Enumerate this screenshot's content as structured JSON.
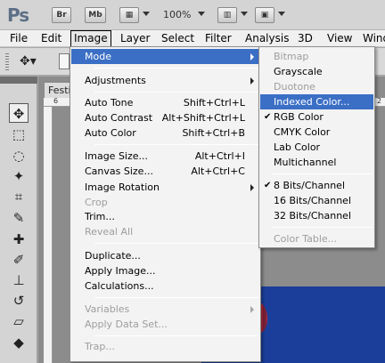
{
  "app": {
    "logo": "Ps",
    "buttons": [
      "Br",
      "Mb"
    ],
    "zoom": "100%"
  },
  "menubar": {
    "items": [
      "File",
      "Edit",
      "Image",
      "Layer",
      "Select",
      "Filter",
      "Analysis",
      "3D",
      "View",
      "Windo"
    ]
  },
  "document": {
    "tab_label": "Festi",
    "ruler_ticks": [
      "6",
      "2"
    ]
  },
  "image_menu": {
    "mode": "Mode",
    "adjustments": "Adjustments",
    "auto_tone": "Auto Tone",
    "auto_tone_sc": "Shift+Ctrl+L",
    "auto_contrast": "Auto Contrast",
    "auto_contrast_sc": "Alt+Shift+Ctrl+L",
    "auto_color": "Auto Color",
    "auto_color_sc": "Shift+Ctrl+B",
    "image_size": "Image Size...",
    "image_size_sc": "Alt+Ctrl+I",
    "canvas_size": "Canvas Size...",
    "canvas_size_sc": "Alt+Ctrl+C",
    "image_rotation": "Image Rotation",
    "crop": "Crop",
    "trim": "Trim...",
    "reveal_all": "Reveal All",
    "duplicate": "Duplicate...",
    "apply_image": "Apply Image...",
    "calculations": "Calculations...",
    "variables": "Variables",
    "apply_data_set": "Apply Data Set...",
    "trap": "Trap..."
  },
  "mode_submenu": {
    "bitmap": "Bitmap",
    "grayscale": "Grayscale",
    "duotone": "Duotone",
    "indexed_color": "Indexed Color...",
    "rgb_color": "RGB Color",
    "cmyk_color": "CMYK Color",
    "lab_color": "Lab Color",
    "multichannel": "Multichannel",
    "bits8": "8 Bits/Channel",
    "bits16": "16 Bits/Channel",
    "bits32": "32 Bits/Channel",
    "color_table": "Color Table...",
    "checkmark": "✔"
  },
  "colors": {
    "highlight": "#3b6fc5",
    "canvas_blue": "#1b3e9a"
  }
}
